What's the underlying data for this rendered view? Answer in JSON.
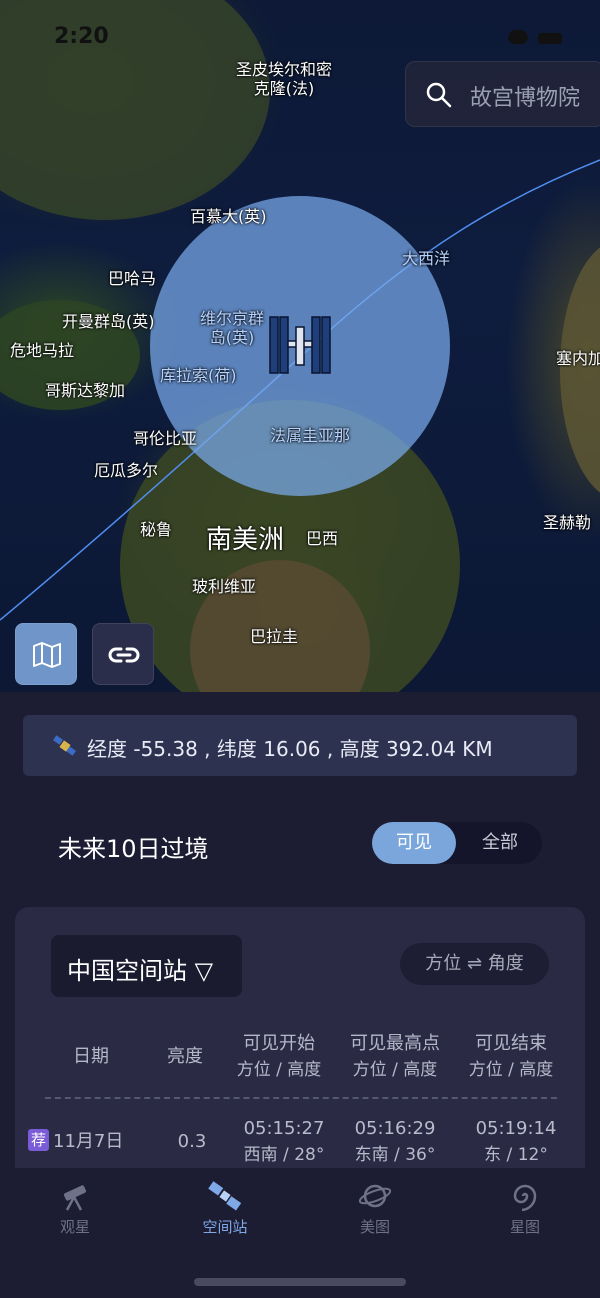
{
  "status": {
    "time": "2:20"
  },
  "search": {
    "placeholder": "故宫博物院",
    "icon": "search-icon"
  },
  "map": {
    "labels": {
      "st_pierre": "圣皮埃尔和密\n克隆(法)",
      "bermuda": "百慕大(英)",
      "bahamas": "巴哈马",
      "atlantic": "大西洋",
      "cayman": "开曼群岛(英)",
      "guatemala": "危地马拉",
      "virgin": "维尔京群\n岛(英)",
      "costa_rica": "哥斯达黎加",
      "curacao": "库拉索(荷)",
      "colombia": "哥伦比亚",
      "french_guiana": "法属圭亚那",
      "ecuador": "厄瓜多尔",
      "peru": "秘鲁",
      "south_america": "南美洲",
      "brazil": "巴西",
      "bolivia": "玻利维亚",
      "paraguay": "巴拉圭",
      "senegal_partial": "塞内加",
      "st_helena_partial": "圣赫勒"
    },
    "buttons": {
      "map_type": "map-icon",
      "link": "link-icon"
    }
  },
  "position": {
    "text": "经度 -55.38 , 纬度 16.06 , 高度 392.04 KM"
  },
  "passes": {
    "title": "未来10日过境",
    "filter": {
      "visible": "可见",
      "all": "全部",
      "selected": "可见"
    },
    "station": "中国空间站 ▽",
    "mode_toggle": "方位 ⇌ 角度",
    "headers": {
      "date": "日期",
      "brightness": "亮度",
      "start": "可见开始",
      "start_sub": "方位 / 高度",
      "peak": "可见最高点",
      "peak_sub": "方位 / 高度",
      "end": "可见结束",
      "end_sub": "方位 / 高度"
    },
    "rows": [
      {
        "badge": "荐",
        "date": "11月7日",
        "brightness": "0.3",
        "start_time": "05:15:27",
        "start_pos": "西南 / 28°",
        "peak_time": "05:16:29",
        "peak_pos": "东南 / 36°",
        "end_time": "05:19:14",
        "end_pos": "东 / 12°"
      }
    ]
  },
  "tabbar": {
    "items": [
      "观星",
      "空间站",
      "美图",
      "星图"
    ],
    "active": "空间站"
  },
  "colors": {
    "accent": "#7aa6db",
    "background": "#1c1c33",
    "card": "#2a2a45"
  }
}
